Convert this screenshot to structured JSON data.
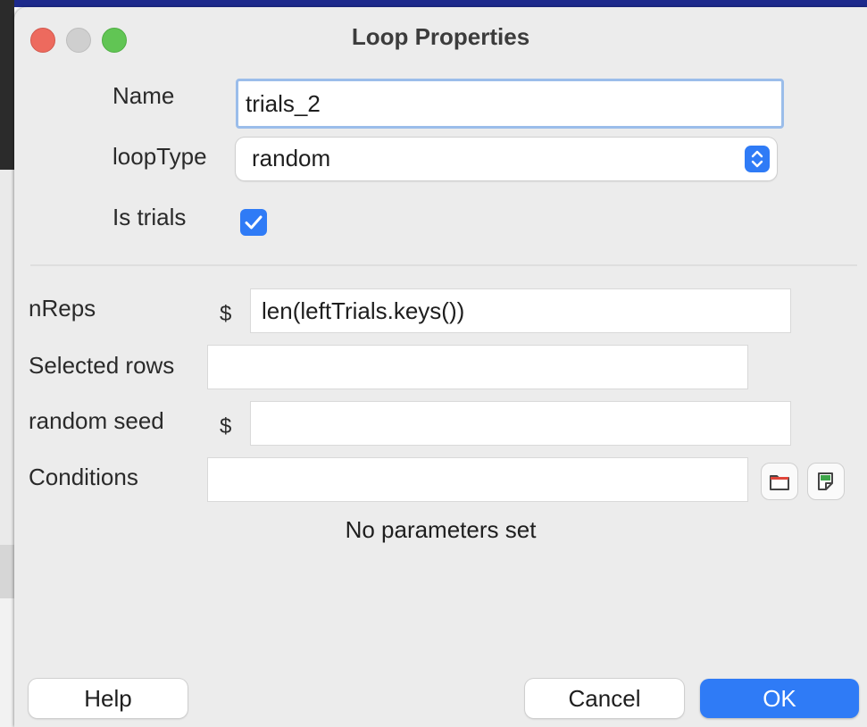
{
  "dialog": {
    "title": "Loop Properties",
    "buttons": {
      "close": "close",
      "minimize": "minimize",
      "zoom": "zoom"
    }
  },
  "fields": {
    "name": {
      "label": "Name",
      "value": "trials_2"
    },
    "loop_type": {
      "label": "loopType",
      "value": "random",
      "icon": "up-down-chevron-icon"
    },
    "is_trials": {
      "label": "Is trials",
      "checked": true,
      "icon": "checkmark-icon"
    },
    "n_reps": {
      "label": "nReps",
      "prefix": "$",
      "value": "len(leftTrials.keys())"
    },
    "selected_rows": {
      "label": "Selected rows",
      "value": ""
    },
    "random_seed": {
      "label": "random seed",
      "prefix": "$",
      "value": ""
    },
    "conditions": {
      "label": "Conditions",
      "value": ""
    }
  },
  "conditions_buttons": {
    "browse_icon": "folder-icon",
    "edit_icon": "document-icon"
  },
  "parameters_status": "No parameters set",
  "footer": {
    "help": "Help",
    "cancel": "Cancel",
    "ok": "OK"
  },
  "colors": {
    "accent": "#2f7bf6",
    "close": "#ed6a5e",
    "minimize": "#cfcfcf",
    "zoom": "#61c554",
    "dialog_bg": "#ececec"
  }
}
